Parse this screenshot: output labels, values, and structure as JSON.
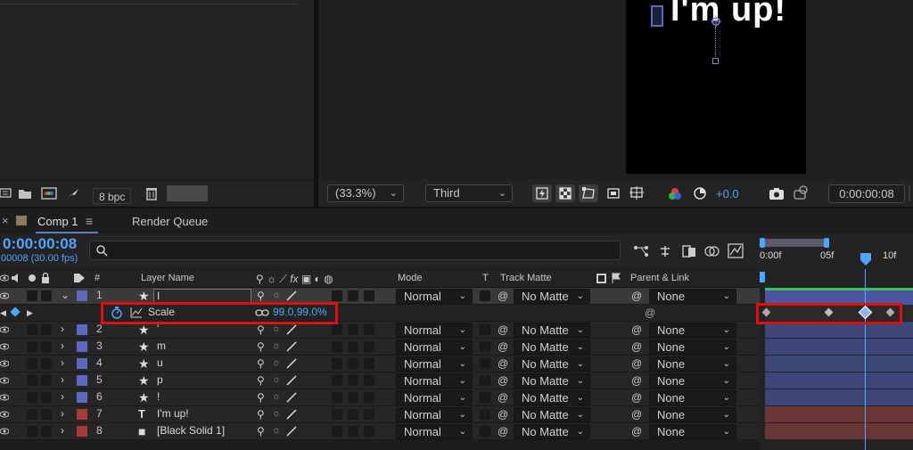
{
  "project": {
    "bpc": "8 bpc"
  },
  "viewer": {
    "canvas_text": "I'm up!",
    "zoom": "(33.3%)",
    "resolution": "Third",
    "exposure": "+0.0",
    "timecode": "0:00:00:08"
  },
  "tabs": {
    "comp": "Comp 1",
    "menu_glyph": "≡",
    "render_queue": "Render Queue"
  },
  "timeline": {
    "timecode": "0:00:00:08",
    "frames": "00008 (30.00 fps)",
    "search_placeholder": "",
    "ruler": [
      "0:00f",
      "05f",
      "10f"
    ]
  },
  "columns": {
    "number": "#",
    "layer_name": "Layer Name",
    "mode": "Mode",
    "t": "T",
    "track_matte": "Track Matte",
    "parent_link": "Parent & Link"
  },
  "property": {
    "name": "Scale",
    "value": "99.0,99.0%"
  },
  "layers": [
    {
      "num": "1",
      "type": "★",
      "name": "I",
      "mode": "Normal",
      "matte": "No Matte",
      "parent": "None",
      "color": "#5b6abf",
      "expanded": true,
      "selected": true
    },
    {
      "num": "2",
      "type": "★",
      "name": "'",
      "mode": "Normal",
      "matte": "No Matte",
      "parent": "None",
      "color": "#5b6abf"
    },
    {
      "num": "3",
      "type": "★",
      "name": "m",
      "mode": "Normal",
      "matte": "No Matte",
      "parent": "None",
      "color": "#5b6abf"
    },
    {
      "num": "4",
      "type": "★",
      "name": "u",
      "mode": "Normal",
      "matte": "No Matte",
      "parent": "None",
      "color": "#5b6abf"
    },
    {
      "num": "5",
      "type": "★",
      "name": "p",
      "mode": "Normal",
      "matte": "No Matte",
      "parent": "None",
      "color": "#5b6abf"
    },
    {
      "num": "6",
      "type": "★",
      "name": "!",
      "mode": "Normal",
      "matte": "No Matte",
      "parent": "None",
      "color": "#5b6abf"
    },
    {
      "num": "7",
      "type": "T",
      "name": "I'm up!",
      "mode": "Normal",
      "matte": "No Matte",
      "parent": "None",
      "color": "#a83a3a"
    },
    {
      "num": "8",
      "type": "■",
      "name": "[Black Solid 1]",
      "mode": "Normal",
      "matte": "No Matte",
      "parent": "None",
      "color": "#a83a3a"
    }
  ],
  "colors": {
    "accent_blue": "#4ea6ff",
    "highlight_red": "#e01010",
    "shape_layer": "#5b6abf",
    "solid_layer": "#a83a3a"
  }
}
